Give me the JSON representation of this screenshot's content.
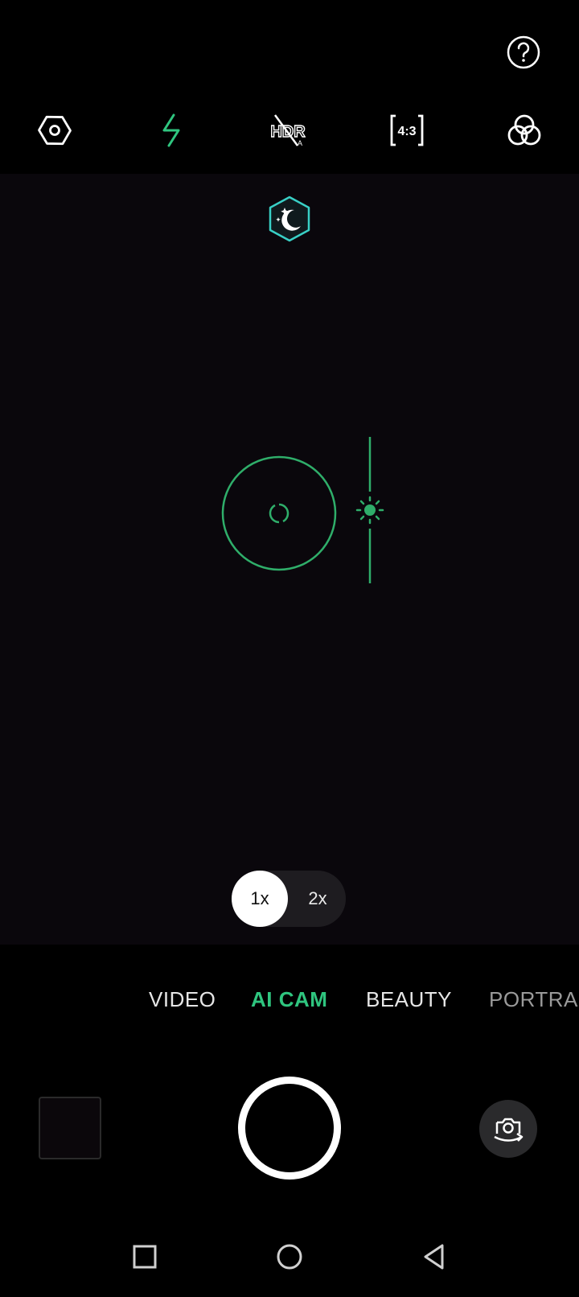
{
  "top_bar": {
    "help_icon": "help-circle-icon",
    "items": [
      {
        "name": "settings-icon"
      },
      {
        "name": "flash-icon",
        "color": "#2fc57f"
      },
      {
        "name": "hdr-off-icon",
        "label": "HDR"
      },
      {
        "name": "aspect-ratio-icon",
        "label": "4:3"
      },
      {
        "name": "filters-icon"
      }
    ]
  },
  "viewfinder": {
    "scene_icon": "night-mode-icon",
    "focus_icon": "focus-ring-icon",
    "exposure_icon": "exposure-slider-icon",
    "accent": "#2fc57f"
  },
  "zoom": {
    "options": [
      "1x",
      "2x"
    ],
    "selected": "1x"
  },
  "modes": {
    "items": [
      "VIDEO",
      "AI CAM",
      "BEAUTY",
      "PORTRA"
    ],
    "selected": "AI CAM"
  },
  "bottom": {
    "gallery": "gallery-thumbnail",
    "shutter": "shutter-button",
    "switch_camera_icon": "switch-camera-icon"
  },
  "nav_bar": {
    "items": [
      "recents-icon",
      "home-icon",
      "back-icon"
    ]
  }
}
